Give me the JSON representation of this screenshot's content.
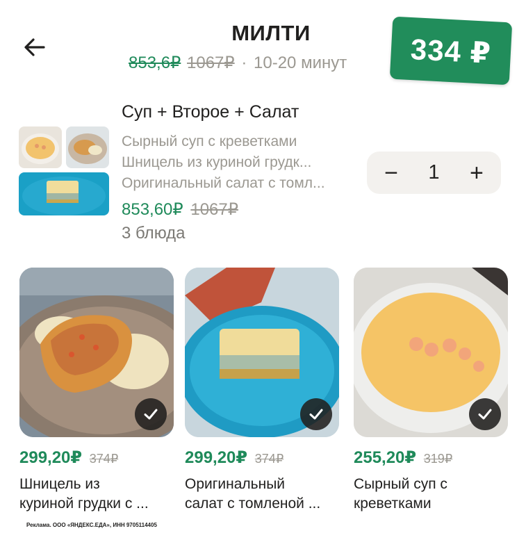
{
  "header": {
    "back_icon": "arrow-left-icon",
    "title": "МИЛТИ",
    "price_new": "853,6₽",
    "price_old": "1067₽",
    "separator": "·",
    "delivery_time": "10-20 минут",
    "sticker_price": "334 ₽"
  },
  "combo": {
    "title": "Суп + Второе + Салат",
    "items": [
      "Сырный суп с креветками",
      "Шницель из куриной грудк...",
      "Оригинальный салат с томл..."
    ],
    "price_new": "853,60₽",
    "price_old": "1067₽",
    "count": "3 блюда",
    "stepper": {
      "minus": "−",
      "quantity": "1",
      "plus": "+"
    }
  },
  "dishes": [
    {
      "price_new": "299,20₽",
      "price_old": "374₽",
      "name_lines": [
        "Шницель из",
        "куриной грудки с ..."
      ],
      "check_icon": "check-icon"
    },
    {
      "price_new": "299,20₽",
      "price_old": "374₽",
      "name_lines": [
        "Оригинальный",
        "салат с томленой ..."
      ],
      "check_icon": "check-icon"
    },
    {
      "price_new": "255,20₽",
      "price_old": "319₽",
      "name_lines": [
        "Сырный суп с",
        "креветками"
      ],
      "check_icon": "check-icon"
    }
  ],
  "ad_text": "Реклама. ООО «ЯНДЕКС.ЕДА», ИНН 9705114405",
  "colors": {
    "accent_green": "#218d5b",
    "price_green": "#1f8a5a",
    "muted": "#9b9891",
    "stepper_bg": "#f3f1ee"
  }
}
